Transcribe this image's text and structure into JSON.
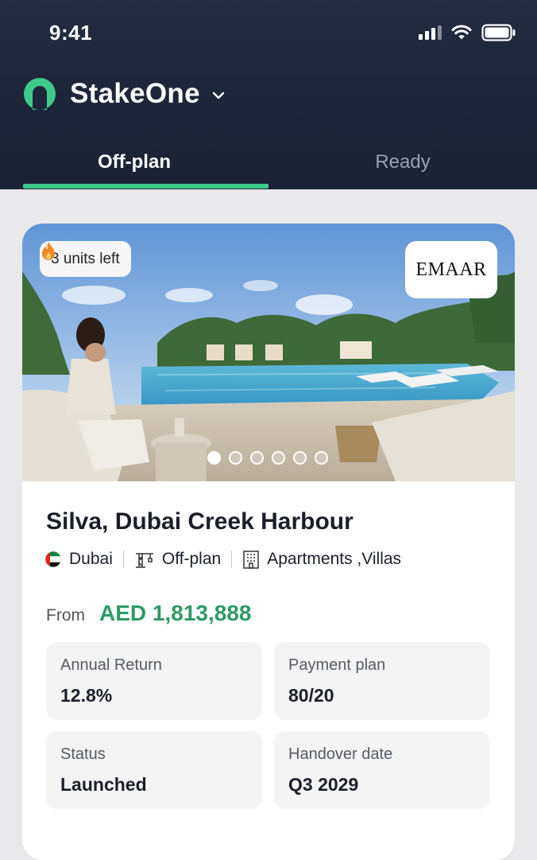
{
  "status_bar": {
    "time": "9:41"
  },
  "header": {
    "brand_name": "StakeOne"
  },
  "tabs": [
    {
      "label": "Off-plan",
      "active": true
    },
    {
      "label": "Ready",
      "active": false
    }
  ],
  "listing": {
    "units_left": "3 units left",
    "developer": "EMAAR",
    "image_count": 6,
    "active_image": 1,
    "title": "Silva, Dubai Creek Harbour",
    "location": "Dubai",
    "stage": "Off-plan",
    "property_types": "Apartments ,Villas",
    "price_prefix": "From",
    "price": "AED 1,813,888",
    "stats": {
      "annual_return": {
        "label": "Annual Return",
        "value": "12.8%"
      },
      "payment_plan": {
        "label": "Payment plan",
        "value": "80/20"
      },
      "status": {
        "label": "Status",
        "value": "Launched"
      },
      "handover": {
        "label": "Handover date",
        "value": "Q3 2029"
      }
    }
  },
  "colors": {
    "accent": "#3ec98b",
    "price": "#2e9a68",
    "header_bg": "#1d2538"
  }
}
